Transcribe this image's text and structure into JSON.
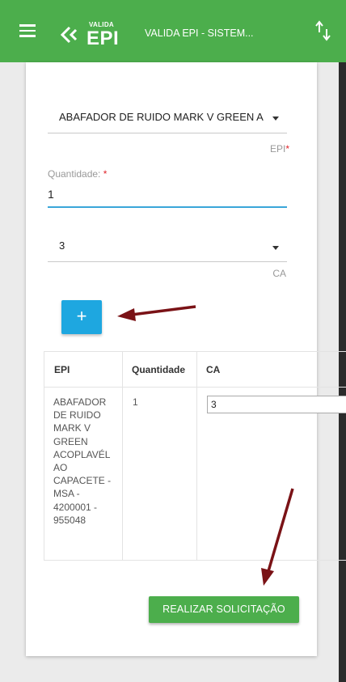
{
  "header": {
    "logo_small": "VALIDA",
    "logo_big": "EPI",
    "title": "VALIDA EPI - SISTEM..."
  },
  "form": {
    "epi_value": "ABAFADOR DE RUIDO MARK V GREEN A",
    "epi_label": "EPI",
    "required_mark": "*",
    "quantity_label": "Quantidade:",
    "quantity_value": "1",
    "ca_value": "3",
    "ca_label": "CA",
    "add_label": "+"
  },
  "table": {
    "headers": [
      "EPI",
      "Quantidade",
      "CA"
    ],
    "rows": [
      {
        "epi_lines": [
          "ABAFADOR",
          "DE RUIDO",
          "MARK V",
          "GREEN",
          "ACOPLAVÉL",
          "AO",
          "CAPACETE -",
          "MSA -",
          "4200001 -",
          "955048"
        ],
        "quantity": "1",
        "ca": "3"
      }
    ]
  },
  "actions": {
    "submit_label": "REALIZAR SOLICITAÇÃO"
  },
  "colors": {
    "appbar": "#4cae4c",
    "accent_blue": "#1ea7e0",
    "annotation_arrow": "#7a1216",
    "required": "#e0242a"
  },
  "icons": [
    "menu-icon",
    "valida-logo-icon",
    "sort-icon",
    "chevron-down-icon",
    "plus-icon",
    "annotation-arrow-icon"
  ]
}
